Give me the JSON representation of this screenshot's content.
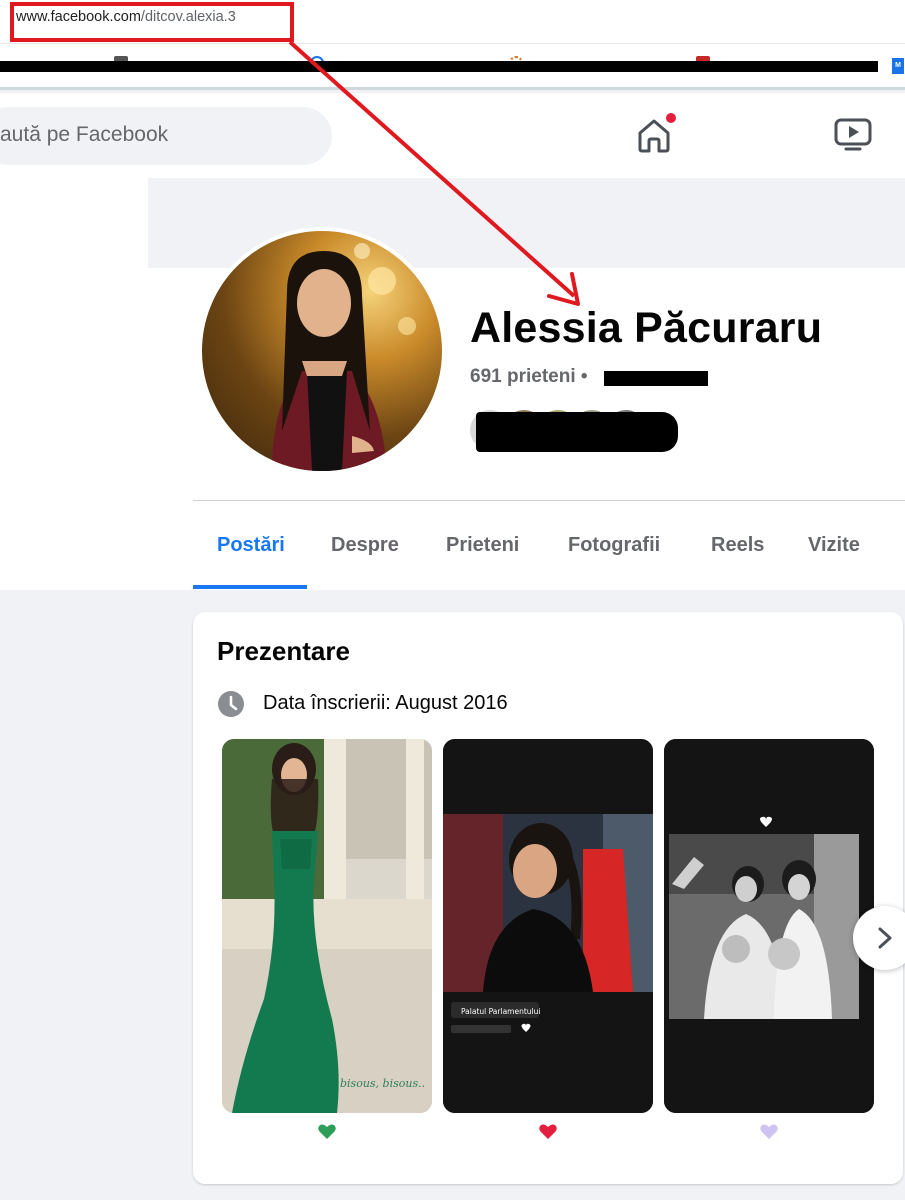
{
  "browser": {
    "url_domain": "www.facebook.com",
    "url_path": "/ditcov.alexia.3"
  },
  "nav": {
    "search_placeholder": "aută pe Facebook",
    "icons": [
      "home-icon",
      "video-icon"
    ]
  },
  "profile": {
    "name": "Alessia Păcuraru",
    "friends_count": "691 prieteni",
    "separator": " •"
  },
  "tabs": [
    "Postări",
    "Despre",
    "Prieteni",
    "Fotografii",
    "Reels",
    "Vizite"
  ],
  "intro": {
    "title": "Prezentare",
    "joined": "Data înscrierii: August 2016"
  },
  "stories": [
    {
      "caption": "bisous, bisous..",
      "heart_color": "#2e9d5a"
    },
    {
      "caption": "Palatul Parlamentului",
      "heart_color": "#e41e3f"
    },
    {
      "caption": "",
      "heart_color": "#cfc3f2"
    }
  ],
  "colors": {
    "accent": "#1877f2",
    "annotation_red": "#e0191f"
  }
}
